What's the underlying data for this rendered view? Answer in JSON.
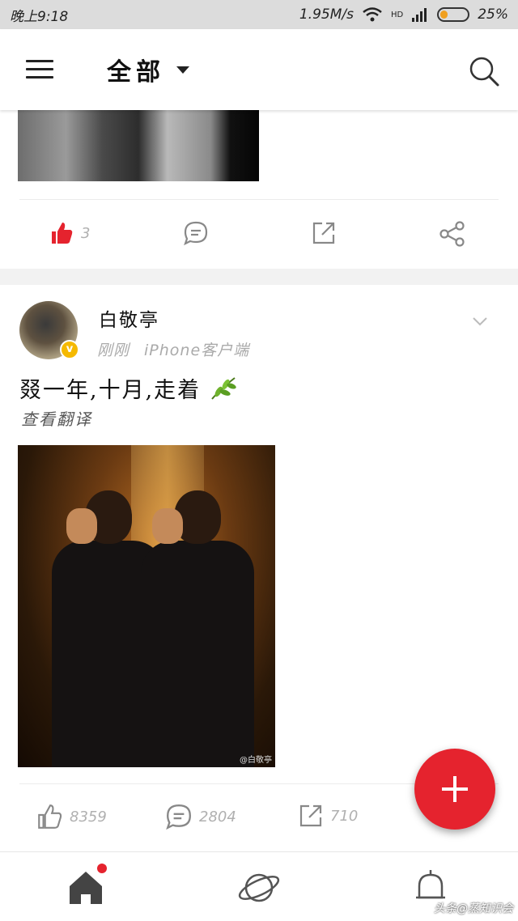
{
  "status_bar": {
    "time": "晚上9:18",
    "network_speed": "1.95M/s",
    "signal_label": "HD",
    "battery": "25%",
    "battery_level": 0.25
  },
  "header": {
    "title": "全部",
    "menu_icon": "menu-icon",
    "search_icon": "search-icon"
  },
  "post1": {
    "actions": {
      "like_count": "3",
      "like_active": true
    }
  },
  "post2": {
    "author": "白敬亭",
    "time": "刚刚",
    "source": "iPhone客户端",
    "text": "叕一年,十月,走着",
    "translate_label": "查看翻译",
    "image_watermark": "@白敬亭",
    "actions": {
      "like_count": "8359",
      "comment_count": "2804",
      "repost_count": "710"
    }
  },
  "colors": {
    "accent": "#e5232e",
    "verified": "#f5b900"
  },
  "bottom_nav": {
    "items": [
      "home-icon",
      "discover-planet-icon",
      "notification-bell-icon"
    ],
    "watermark": "头条@蒸知识会"
  }
}
